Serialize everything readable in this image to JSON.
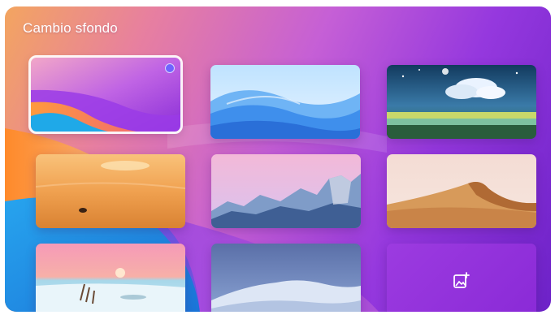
{
  "dialog": {
    "title": "Cambio sfondo"
  },
  "wallpapers": [
    {
      "id": "purple-waves",
      "selected": true
    },
    {
      "id": "blue-dunes",
      "selected": false
    },
    {
      "id": "sky-clouds-meadow",
      "selected": false
    },
    {
      "id": "desert-sunset-orange",
      "selected": false
    },
    {
      "id": "snowy-mountain-range",
      "selected": false
    },
    {
      "id": "sand-dune",
      "selected": false
    },
    {
      "id": "pink-beach-sunset",
      "selected": false
    },
    {
      "id": "blue-mountain-snow",
      "selected": false
    }
  ],
  "add_tile": {
    "icon": "add-image-icon"
  },
  "colors": {
    "accent": "#6f63ff",
    "background_start": "#f3a560",
    "background_end": "#6d22c8"
  }
}
